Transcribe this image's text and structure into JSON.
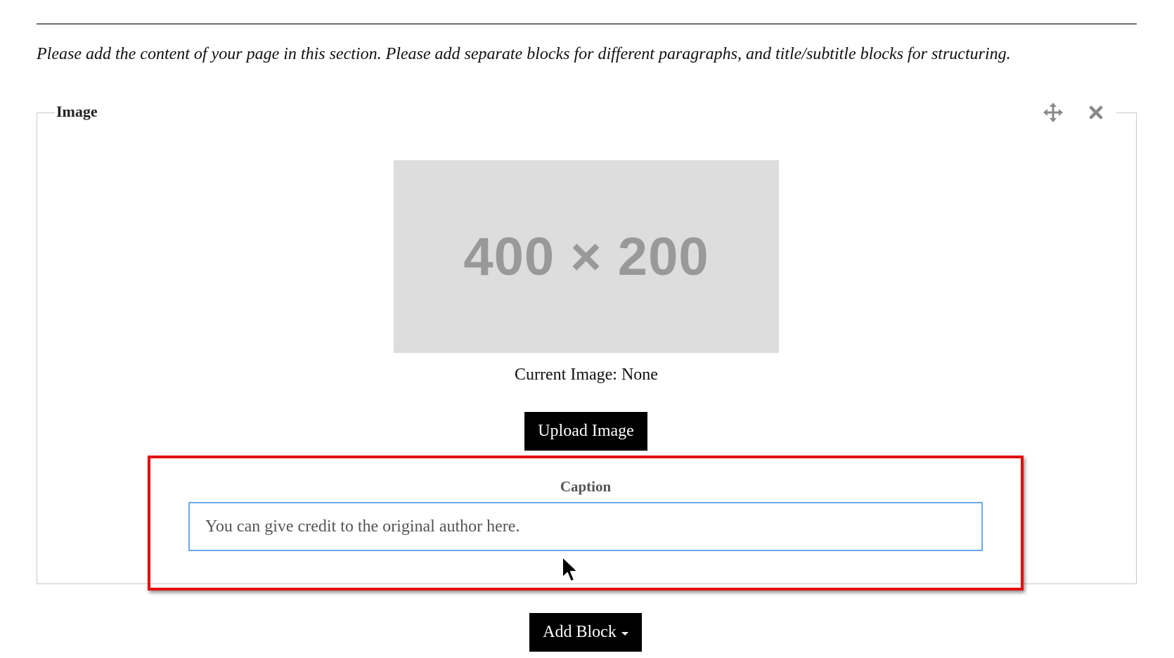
{
  "intro": {
    "text": "Please add the content of your page in this section. Please add separate blocks for different paragraphs, and title/subtitle blocks for structuring."
  },
  "image_block": {
    "title": "Image",
    "placeholder_text": "400 × 200",
    "current_image_text": "Current Image: None",
    "upload_label": "Upload Image",
    "move_icon": "move-arrows-icon",
    "close_icon": "close-icon"
  },
  "caption": {
    "label": "Caption",
    "value": "You can give credit to the original author here.",
    "placeholder": ""
  },
  "footer": {
    "add_block_label": "Add Block"
  },
  "colors": {
    "button_bg": "#000000",
    "highlight": "#e01010",
    "input_focus_border": "#6aa9e9",
    "placeholder_bg": "#dddddd"
  }
}
